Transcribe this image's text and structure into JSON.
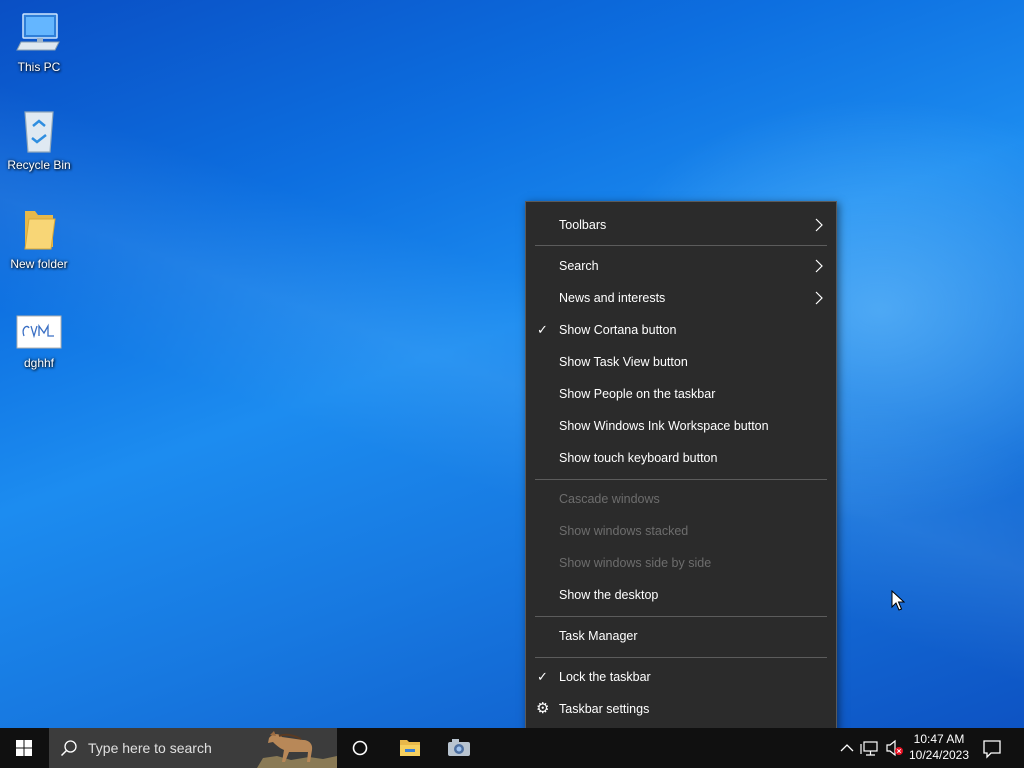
{
  "desktop": {
    "icons": [
      {
        "label": "This PC",
        "icon": "this-pc-icon"
      },
      {
        "label": "Recycle Bin",
        "icon": "recycle-bin-icon"
      },
      {
        "label": "New folder",
        "icon": "folder-icon"
      },
      {
        "label": "dghhf",
        "icon": "image-file-icon"
      }
    ]
  },
  "context_menu": {
    "items": [
      {
        "label": "Toolbars",
        "has_submenu": true
      },
      {
        "label": "Search",
        "has_submenu": true
      },
      {
        "label": "News and interests",
        "has_submenu": true
      },
      {
        "label": "Show Cortana button",
        "checked": true
      },
      {
        "label": "Show Task View button"
      },
      {
        "label": "Show People on the taskbar"
      },
      {
        "label": "Show Windows Ink Workspace button"
      },
      {
        "label": "Show touch keyboard button"
      },
      {
        "label": "Cascade windows",
        "disabled": true
      },
      {
        "label": "Show windows stacked",
        "disabled": true
      },
      {
        "label": "Show windows side by side",
        "disabled": true
      },
      {
        "label": "Show the desktop"
      },
      {
        "label": "Task Manager"
      },
      {
        "label": "Lock the taskbar",
        "checked": true
      },
      {
        "label": "Taskbar settings",
        "icon": "gear-icon"
      }
    ],
    "check_mark": "✓",
    "gear_glyph": "⚙"
  },
  "taskbar": {
    "search_placeholder": "Type here to search",
    "pinned": [
      "cortana-icon",
      "file-explorer-icon",
      "camera-icon"
    ],
    "tray": [
      "show-hidden-icons-icon",
      "network-icon",
      "volume-muted-icon"
    ],
    "clock": {
      "time": "10:47 AM",
      "date": "10/24/2023"
    },
    "notification_icon": "action-center-icon"
  },
  "colors": {
    "desktop_blue": "#0d6fe0",
    "menu_bg": "#2b2b2b",
    "taskbar_bg": "#101010",
    "disabled_text": "#6d6d6d"
  }
}
